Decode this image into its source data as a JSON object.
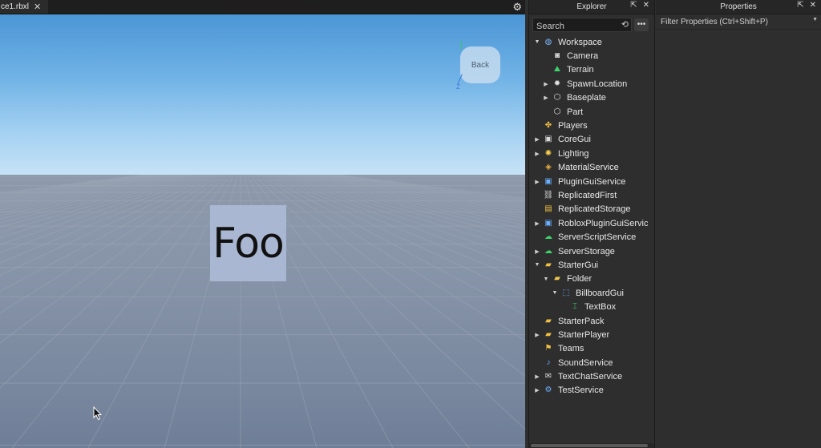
{
  "document_tab": {
    "name": "ce1.rbxl",
    "close": "✕"
  },
  "viewport": {
    "billboard_text": "Foo",
    "view_cube_label": "Back",
    "axis_z": "Z"
  },
  "explorer": {
    "title": "Explorer",
    "search_placeholder": "Search",
    "items": [
      {
        "label": "Workspace",
        "depth": 0,
        "arrow": "expanded",
        "icon": "workspace-icon",
        "glyph": "◍",
        "color": "#7db7ff"
      },
      {
        "label": "Camera",
        "depth": 1,
        "arrow": "none",
        "icon": "camera-icon",
        "glyph": "◙",
        "color": "#e0e0e0"
      },
      {
        "label": "Terrain",
        "depth": 1,
        "arrow": "none",
        "icon": "terrain-icon",
        "glyph": "⛰",
        "color": "#3fd36b"
      },
      {
        "label": "SpawnLocation",
        "depth": 1,
        "arrow": "collapsed",
        "icon": "spawn-location-icon",
        "glyph": "✹",
        "color": "#e0e0e0"
      },
      {
        "label": "Baseplate",
        "depth": 1,
        "arrow": "collapsed",
        "icon": "part-icon",
        "glyph": "⬡",
        "color": "#e0e0e0"
      },
      {
        "label": "Part",
        "depth": 1,
        "arrow": "none",
        "icon": "part-icon",
        "glyph": "⬡",
        "color": "#e0e0e0"
      },
      {
        "label": "Players",
        "depth": 0,
        "arrow": "none",
        "icon": "players-icon",
        "glyph": "✤",
        "color": "#f0c040"
      },
      {
        "label": "CoreGui",
        "depth": 0,
        "arrow": "collapsed",
        "icon": "core-gui-icon",
        "glyph": "▣",
        "color": "#d8d8d8"
      },
      {
        "label": "Lighting",
        "depth": 0,
        "arrow": "collapsed",
        "icon": "lighting-icon",
        "glyph": "✺",
        "color": "#ffd54a"
      },
      {
        "label": "MaterialService",
        "depth": 0,
        "arrow": "none",
        "icon": "material-service-icon",
        "glyph": "◈",
        "color": "#f0b040"
      },
      {
        "label": "PluginGuiService",
        "depth": 0,
        "arrow": "collapsed",
        "icon": "plugin-gui-service-icon",
        "glyph": "▣",
        "color": "#6ab0ff"
      },
      {
        "label": "ReplicatedFirst",
        "depth": 0,
        "arrow": "none",
        "icon": "replicated-first-icon",
        "glyph": "⛓",
        "color": "#d8d8d8"
      },
      {
        "label": "ReplicatedStorage",
        "depth": 0,
        "arrow": "none",
        "icon": "replicated-storage-icon",
        "glyph": "▤",
        "color": "#f0c040"
      },
      {
        "label": "RobloxPluginGuiServic",
        "depth": 0,
        "arrow": "collapsed",
        "icon": "roblox-plugin-gui-service-icon",
        "glyph": "▣",
        "color": "#6ab0ff"
      },
      {
        "label": "ServerScriptService",
        "depth": 0,
        "arrow": "none",
        "icon": "server-script-service-icon",
        "glyph": "☁",
        "color": "#3fd36b"
      },
      {
        "label": "ServerStorage",
        "depth": 0,
        "arrow": "collapsed",
        "icon": "server-storage-icon",
        "glyph": "☁",
        "color": "#3fd36b"
      },
      {
        "label": "StarterGui",
        "depth": 0,
        "arrow": "expanded",
        "icon": "starter-gui-icon",
        "glyph": "▰",
        "color": "#f0c040"
      },
      {
        "label": "Folder",
        "depth": 1,
        "arrow": "expanded",
        "icon": "folder-icon",
        "glyph": "▰",
        "color": "#f2c94c"
      },
      {
        "label": "BillboardGui",
        "depth": 2,
        "arrow": "expanded",
        "icon": "billboard-gui-icon",
        "glyph": "⬚",
        "color": "#6ab0ff"
      },
      {
        "label": "TextBox",
        "depth": 3,
        "arrow": "none",
        "icon": "text-box-icon",
        "glyph": "⌶",
        "color": "#3fd36b"
      },
      {
        "label": "StarterPack",
        "depth": 0,
        "arrow": "none",
        "icon": "starter-pack-icon",
        "glyph": "▰",
        "color": "#f0c040"
      },
      {
        "label": "StarterPlayer",
        "depth": 0,
        "arrow": "collapsed",
        "icon": "starter-player-icon",
        "glyph": "▰",
        "color": "#f0c040"
      },
      {
        "label": "Teams",
        "depth": 0,
        "arrow": "none",
        "icon": "teams-icon",
        "glyph": "⚑",
        "color": "#f0c040"
      },
      {
        "label": "SoundService",
        "depth": 0,
        "arrow": "none",
        "icon": "sound-service-icon",
        "glyph": "♪",
        "color": "#6ab0ff"
      },
      {
        "label": "TextChatService",
        "depth": 0,
        "arrow": "collapsed",
        "icon": "text-chat-service-icon",
        "glyph": "✉",
        "color": "#d8d8d8"
      },
      {
        "label": "TestService",
        "depth": 0,
        "arrow": "collapsed",
        "icon": "test-service-icon",
        "glyph": "⚙",
        "color": "#6ab0ff"
      }
    ]
  },
  "properties": {
    "title": "Properties",
    "filter_placeholder": "Filter Properties (Ctrl+Shift+P)"
  }
}
